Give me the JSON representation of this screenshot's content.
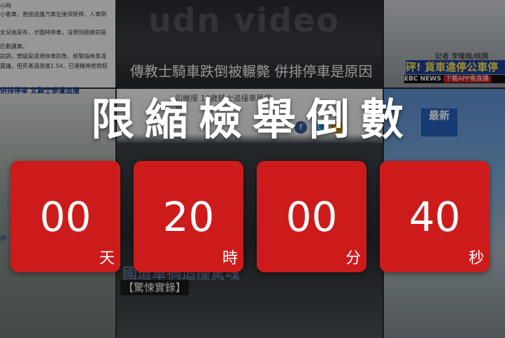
{
  "background": {
    "left_top_lines": [
      "小客車，直接追撞汽車左後保險桿，人車倒",
      "女兒換尿布，才臨時停車，沒想到剛換完尿",
      "仍救護車。",
      "說詞，懷疑是違規停車釣魚，檢警指林某違",
      "異議，但死者酒測值1.54，已達精神恍惚程"
    ],
    "left_top_first": "小時",
    "left_link": "併排停車 女騎士慘遭追撞",
    "left_bottom": "停",
    "watermark": "udn video",
    "video_subtitle": "傳教士騎車跌倒被輾斃  併排停車是原因",
    "reporter": "記者 李隆翰/桃園",
    "news_banner": "砰! 貨車違停公車停",
    "ticker_channel": "EBC",
    "ticker_news": "NEWS",
    "ticker_app": "下載APP看直播",
    "article_title": "司機撞          19歲騎士追撞車尾當",
    "article_sub": "死",
    "bottom_caption": "國道車禍追撞驚魂",
    "tag_label": "【驚悚實錄】",
    "signboard": "最新"
  },
  "countdown": {
    "title": "限縮檢舉倒數",
    "tiles": [
      {
        "value": "00",
        "unit": "天"
      },
      {
        "value": "20",
        "unit": "時"
      },
      {
        "value": "00",
        "unit": "分"
      },
      {
        "value": "40",
        "unit": "秒"
      }
    ]
  },
  "colors": {
    "tile": "#cd1b1b",
    "title": "#ffffff",
    "facebook": "#3b5998",
    "twitter": "#1da1f2",
    "share": "#e49b0f"
  },
  "icons": [
    "facebook-icon",
    "twitter-icon",
    "share-icon"
  ]
}
